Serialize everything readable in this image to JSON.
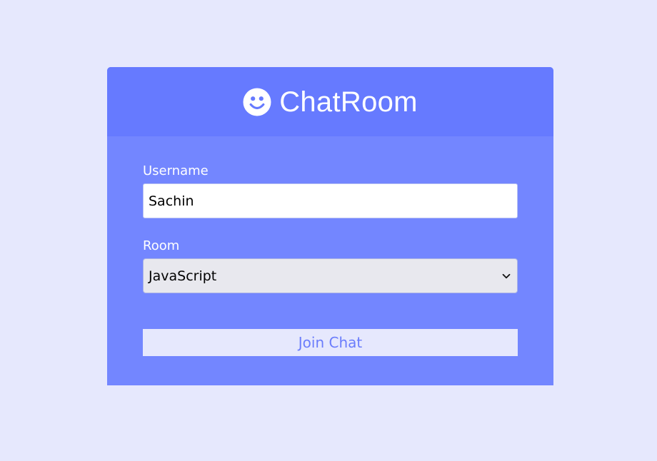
{
  "header": {
    "logo_icon": "smiley-face-icon",
    "title": "ChatRoom"
  },
  "form": {
    "username_label": "Username",
    "username_value": "Sachin",
    "room_label": "Room",
    "room_selected": "JavaScript",
    "submit_label": "Join Chat"
  },
  "colors": {
    "page_background": "#e6e8fd",
    "header_background": "#667aff",
    "body_background": "#7386ff",
    "button_text": "#6b7dfc"
  }
}
